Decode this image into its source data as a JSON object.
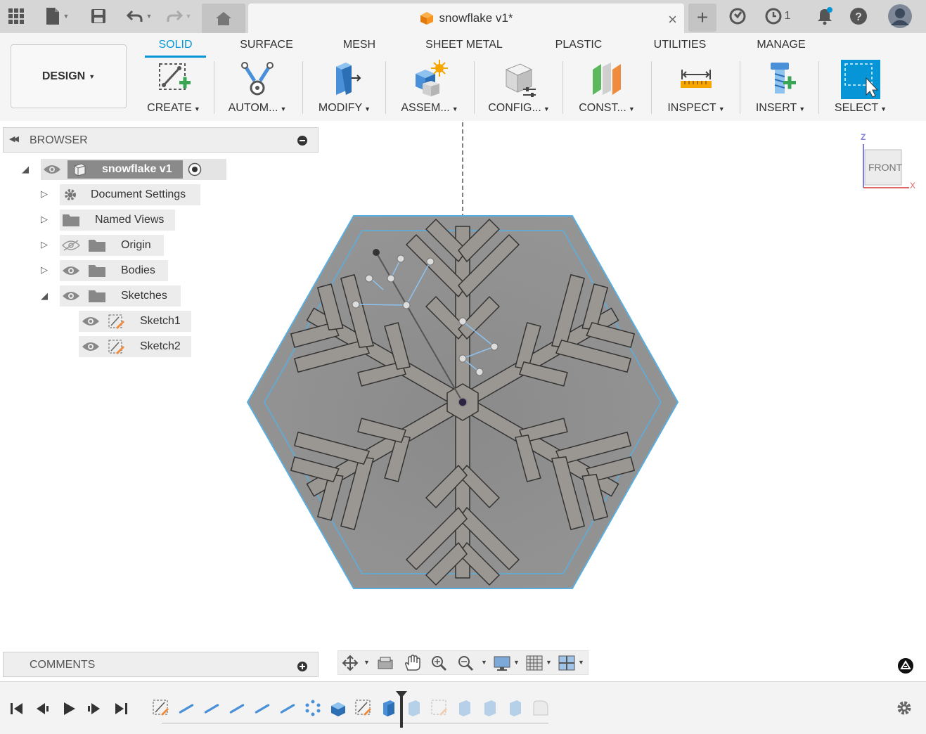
{
  "document": {
    "tab_title": "snowflake v1*",
    "jobs_count": "1"
  },
  "ribbon": {
    "workspace": "DESIGN",
    "tabs": [
      "SOLID",
      "SURFACE",
      "MESH",
      "SHEET METAL",
      "PLASTIC",
      "UTILITIES",
      "MANAGE"
    ],
    "active_tab": "SOLID",
    "tools": [
      {
        "label": "CREATE",
        "icon": "create-sketch-icon"
      },
      {
        "label": "AUTOM...",
        "icon": "automate-icon"
      },
      {
        "label": "MODIFY",
        "icon": "modify-press-pull-icon"
      },
      {
        "label": "ASSEM...",
        "icon": "assemble-new-component-icon"
      },
      {
        "label": "CONFIG...",
        "icon": "configure-icon"
      },
      {
        "label": "CONST...",
        "icon": "construct-plane-icon"
      },
      {
        "label": "INSPECT",
        "icon": "measure-icon"
      },
      {
        "label": "INSERT",
        "icon": "insert-bolt-icon"
      },
      {
        "label": "SELECT",
        "icon": "select-window-icon"
      }
    ]
  },
  "browser": {
    "title": "BROWSER",
    "root": "snowflake v1",
    "items": [
      {
        "label": "Document Settings",
        "icon": "gear-icon"
      },
      {
        "label": "Named Views",
        "icon": "folder-icon"
      },
      {
        "label": "Origin",
        "icon": "folder-icon",
        "visibility": "hidden"
      },
      {
        "label": "Bodies",
        "icon": "folder-icon",
        "visibility": "visible"
      },
      {
        "label": "Sketches",
        "icon": "folder-icon",
        "visibility": "visible",
        "expanded": true
      }
    ],
    "sketches": [
      "Sketch1",
      "Sketch2"
    ]
  },
  "viewcube": {
    "face": "FRONT",
    "axis_z": "Z",
    "axis_x": "X"
  },
  "comments": {
    "title": "COMMENTS"
  },
  "colors": {
    "accent": "#0696d7",
    "body_fill": "#8e8e8e",
    "edge_highlight": "#5aaee0",
    "topbar": "#d6d6d6",
    "ribbon": "#f5f5f5"
  }
}
